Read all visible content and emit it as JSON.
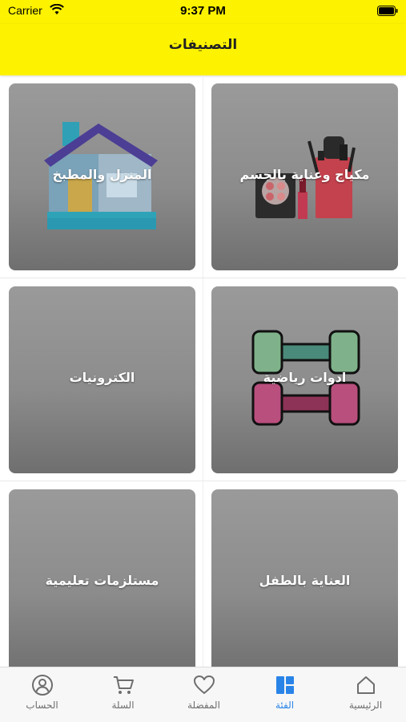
{
  "status_bar": {
    "carrier": "Carrier",
    "time": "9:37 PM"
  },
  "nav": {
    "title": "التصنيفات"
  },
  "categories": [
    {
      "label": "مكياج وعناية بالجسم",
      "icon": "makeup-icon"
    },
    {
      "label": "المنزل والمطبخ",
      "icon": "house-icon"
    },
    {
      "label": "ادوات رياضية",
      "icon": "dumbbell-icon"
    },
    {
      "label": "الكترونيات",
      "icon": ""
    },
    {
      "label": "العناية بالطفل",
      "icon": ""
    },
    {
      "label": "مستلزمات تعليمية",
      "icon": ""
    }
  ],
  "tabs": [
    {
      "label": "الرئيسية",
      "icon": "home-icon",
      "active": false
    },
    {
      "label": "الفئة",
      "icon": "category-grid-icon",
      "active": true
    },
    {
      "label": "المفضلة",
      "icon": "heart-icon",
      "active": false
    },
    {
      "label": "السلة",
      "icon": "cart-icon",
      "active": false
    },
    {
      "label": "الحساب",
      "icon": "account-icon",
      "active": false
    }
  ],
  "colors": {
    "header": "#fdf200",
    "active_tab": "#2a84e8",
    "inactive_tab": "#6e6e6e",
    "card": "#8c8c8c"
  }
}
